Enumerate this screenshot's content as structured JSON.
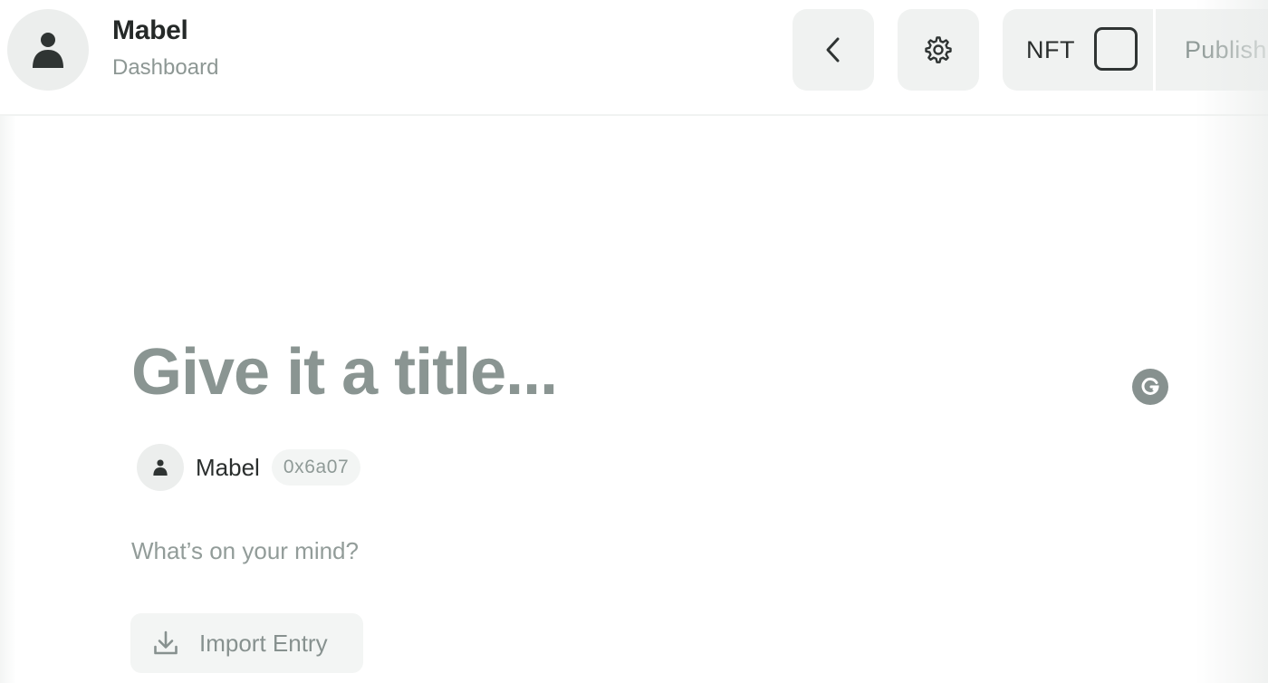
{
  "header": {
    "user_name": "Mabel",
    "user_subtitle": "Dashboard",
    "avatar_icon": "person-icon",
    "back_icon": "chevron-left-icon",
    "settings_icon": "gear-icon",
    "nft_label": "NFT",
    "nft_checked": false,
    "publish_label": "Publish"
  },
  "editor": {
    "title_placeholder": "Give it a title...",
    "author_name": "Mabel",
    "author_address": "0x6a07",
    "body_placeholder": "What’s on your mind?",
    "import_label": "Import Entry",
    "import_icon": "download-icon",
    "assistant_icon": "grammarly-icon"
  },
  "colors": {
    "title_placeholder": "#8a9592",
    "button_bg": "#f0f2f1",
    "muted_text": "#8f9a97",
    "dark_text": "#252928"
  }
}
